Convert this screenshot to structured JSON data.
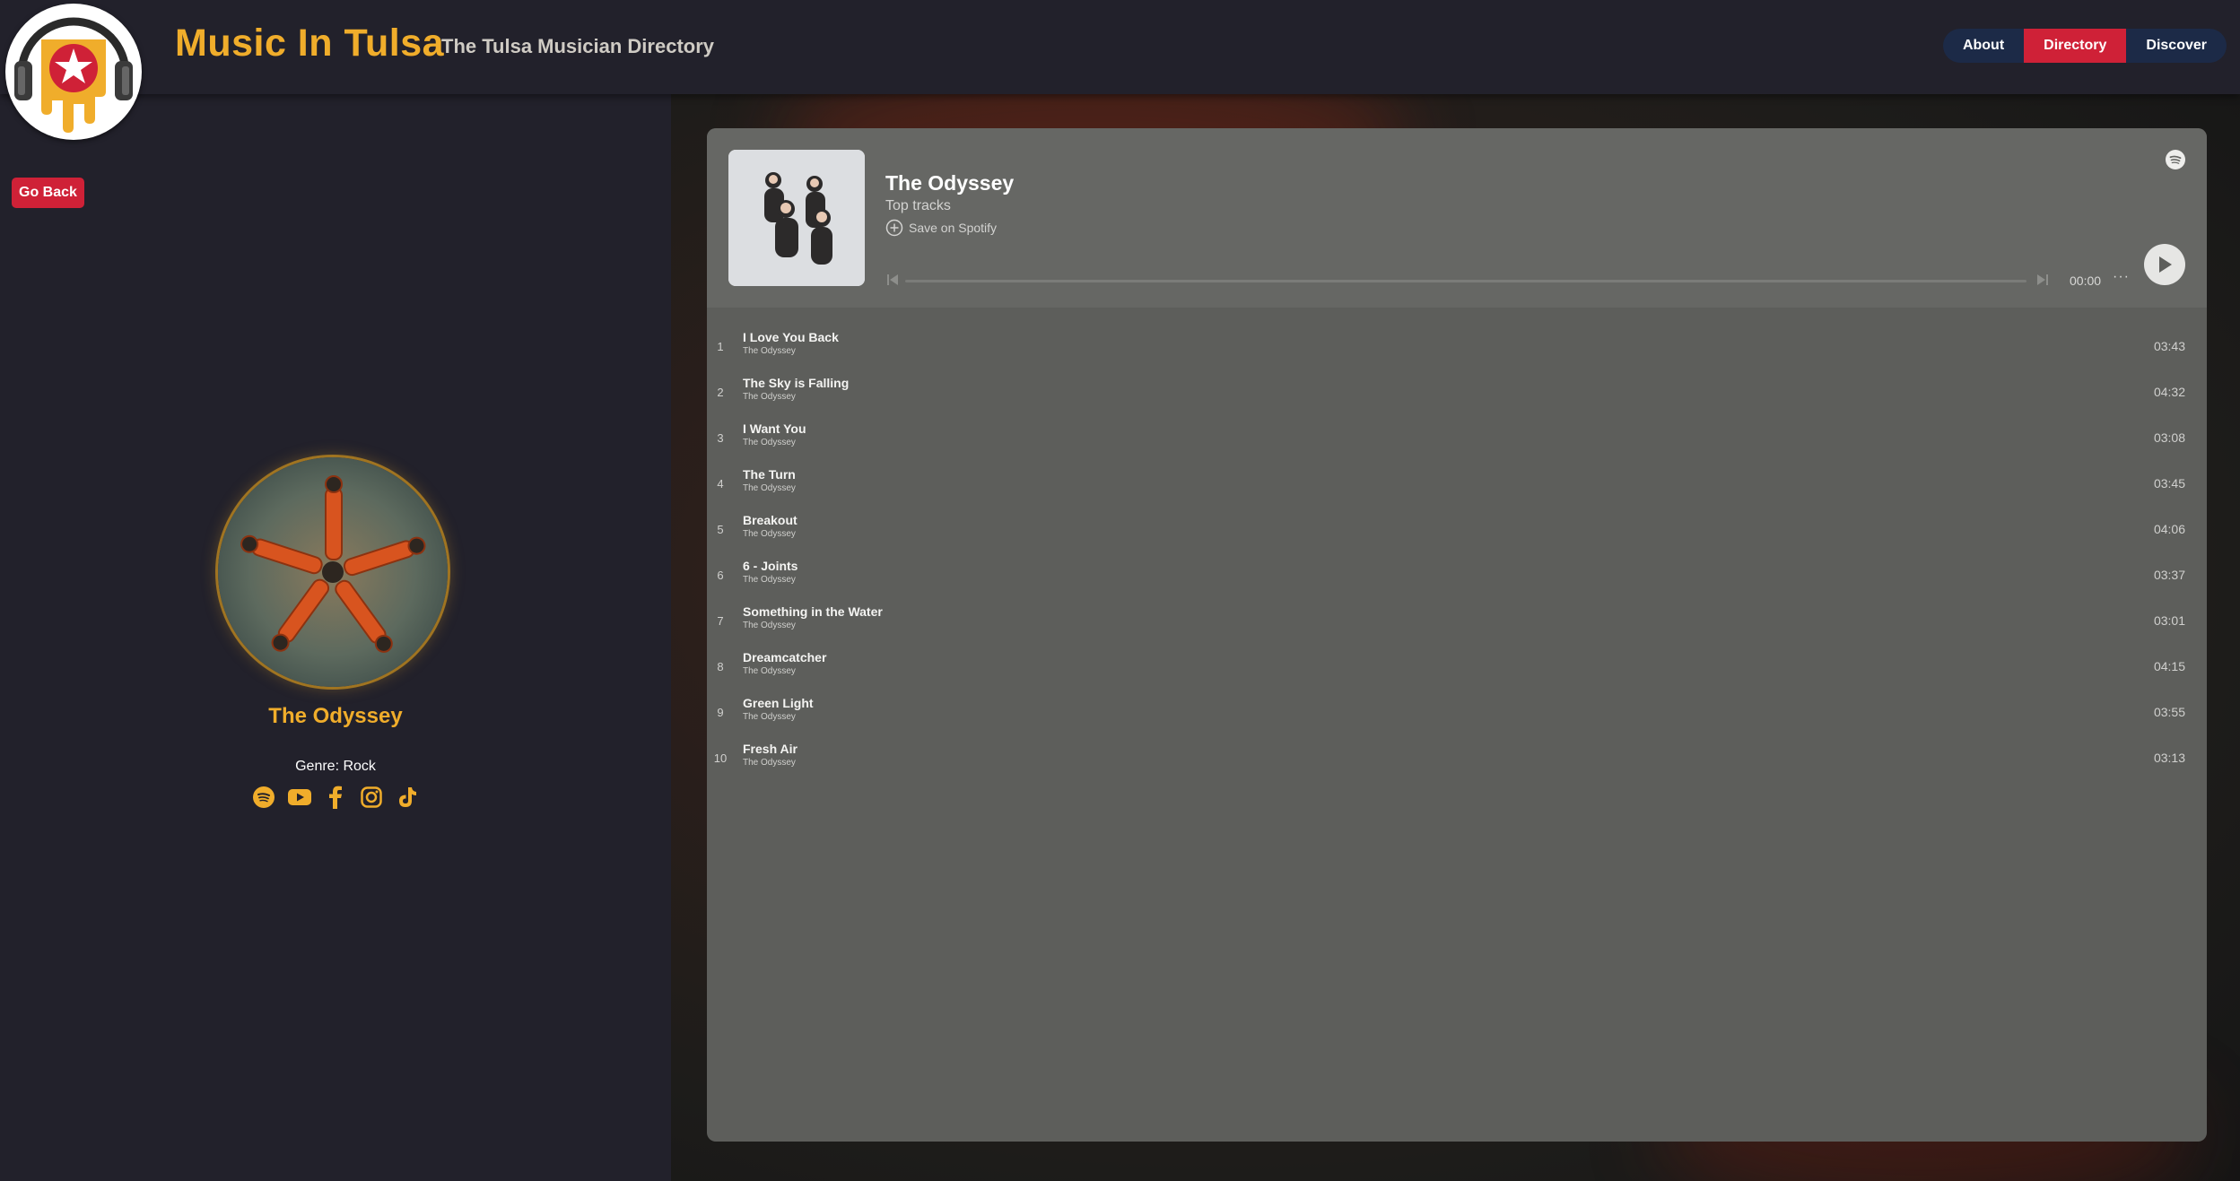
{
  "header": {
    "title": "Music In Tulsa",
    "subtitle": "The Tulsa Musician Directory",
    "nav": [
      {
        "label": "About"
      },
      {
        "label": "Directory",
        "active": true
      },
      {
        "label": "Discover"
      }
    ]
  },
  "left": {
    "go_back": "Go Back",
    "artist_name": "The Odyssey",
    "genre": "Genre: Rock",
    "social_icons": [
      "spotify-icon",
      "youtube-icon",
      "facebook-icon",
      "instagram-icon",
      "tiktok-icon"
    ]
  },
  "player": {
    "title": "The Odyssey",
    "subtitle": "Top tracks",
    "save_label": "Save on Spotify",
    "time": "00:00",
    "more": "···",
    "progress_fraction": 0,
    "tracks": [
      {
        "num": "1",
        "name": "I Love You Back",
        "artist": "The Odyssey",
        "duration": "03:43"
      },
      {
        "num": "2",
        "name": "The Sky is Falling",
        "artist": "The Odyssey",
        "duration": "04:32"
      },
      {
        "num": "3",
        "name": "I Want You",
        "artist": "The Odyssey",
        "duration": "03:08"
      },
      {
        "num": "4",
        "name": "The Turn",
        "artist": "The Odyssey",
        "duration": "03:45"
      },
      {
        "num": "5",
        "name": "Breakout",
        "artist": "The Odyssey",
        "duration": "04:06"
      },
      {
        "num": "6",
        "name": "6 - Joints",
        "artist": "The Odyssey",
        "duration": "03:37"
      },
      {
        "num": "7",
        "name": "Something in the Water",
        "artist": "The Odyssey",
        "duration": "03:01"
      },
      {
        "num": "8",
        "name": "Dreamcatcher",
        "artist": "The Odyssey",
        "duration": "04:15"
      },
      {
        "num": "9",
        "name": "Green Light",
        "artist": "The Odyssey",
        "duration": "03:55"
      },
      {
        "num": "10",
        "name": "Fresh Air",
        "artist": "The Odyssey",
        "duration": "03:13"
      }
    ]
  },
  "colors": {
    "accent_gold": "#f0ad2b",
    "accent_red": "#cf2137",
    "nav_bg": "#1c2a47",
    "page_bg": "#22212b",
    "player_bg": "#5d5e5b"
  }
}
